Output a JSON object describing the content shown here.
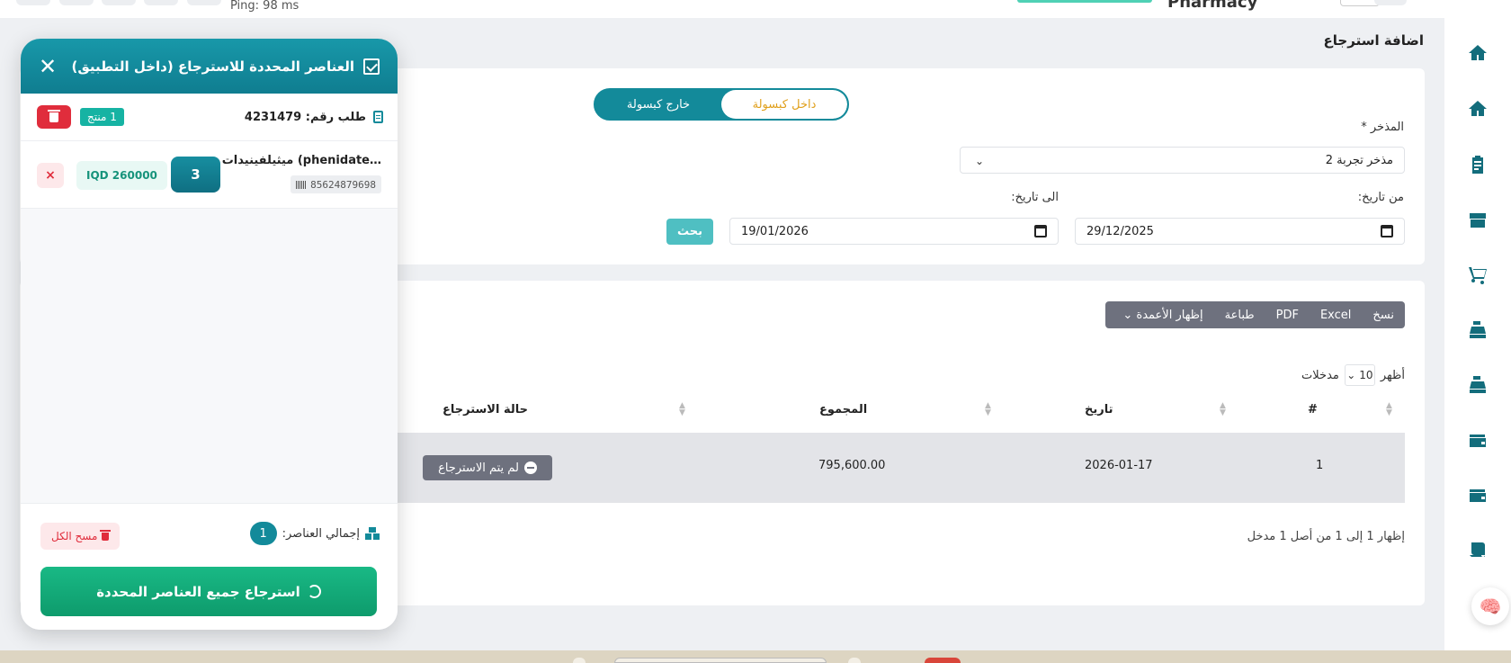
{
  "topbar": {
    "ping": "Ping: 98 ms",
    "title_partial": "Pharmacy"
  },
  "page": {
    "title": "اضافة استرجاع"
  },
  "filter": {
    "toggle": {
      "active": "داخل كبسولة",
      "inactive": "خارج كبسولة"
    },
    "store_label": "المذخر *",
    "store_value": "مذخر تجربة 2",
    "from_label": "من تاريخ:",
    "from_value": "29/12/2025",
    "to_label": "الى تاريخ:",
    "to_value": "19/01/2026",
    "search_button": "بحث"
  },
  "table": {
    "export_buttons": [
      "نسخ",
      "Excel",
      "PDF",
      "طباعة",
      "إظهار الأعمدة"
    ],
    "show_label": "أظهر",
    "entries_value": "10",
    "entries_label": "مدخلات",
    "headers": {
      "num": "#",
      "date": "تاريخ",
      "total": "المجموع",
      "status": "حالة الاسترجاع"
    },
    "rows": [
      {
        "num": "1",
        "date": "2026-01-17",
        "total": "795,600.00",
        "status": "لم يتم الاسترجاع"
      }
    ],
    "footer": "إظهار 1 إلى 1 من أصل 1 مدخل"
  },
  "panel": {
    "title": "العناصر المحددة للاسترجاع (داخل التطبيق)",
    "order_label": "طلب رقم: 4231479",
    "order_count": "1 منتج",
    "item": {
      "name": "…phenidate) ميثيلفينيدات",
      "barcode": "85624879698",
      "qty": "3",
      "price": "IQD 260000",
      "remove": "×"
    },
    "total_label": "إجمالي العناصر:",
    "total_value": "1",
    "clear_all": "مسح الكل",
    "return_all": "استرجاع جميع العناصر المحددة"
  },
  "colors": {
    "primary": "#138a9a",
    "success": "#16b17a",
    "danger": "#e02d3c",
    "accent": "#e0a01c"
  }
}
